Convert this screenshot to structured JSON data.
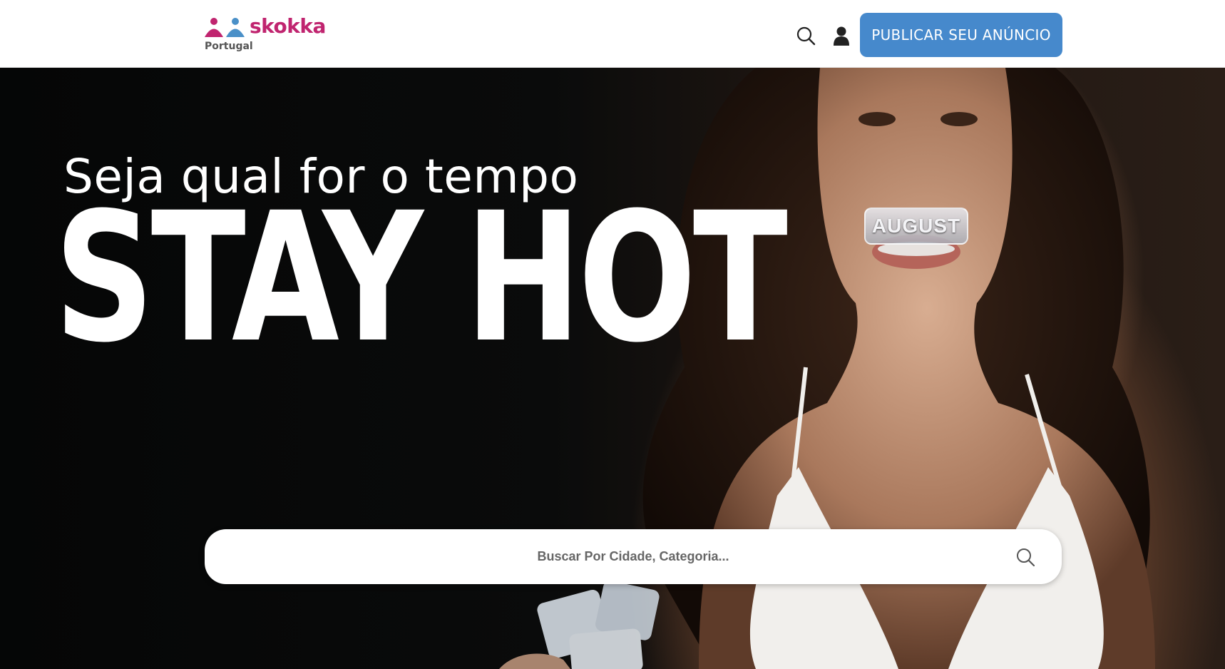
{
  "header": {
    "logo_text": "skokka",
    "logo_sub": "Portugal",
    "cta_label": "PUBLICAR SEU ANÚNCIO",
    "icons": [
      "search-icon",
      "user-icon"
    ]
  },
  "hero": {
    "tagline": "Seja qual for o tempo",
    "headline": "STAY HOT",
    "ice_text": "AUGUST"
  },
  "search": {
    "placeholder": "Buscar Por Cidade, Categoria..."
  },
  "colors": {
    "brand": "#c0246f",
    "brand_secondary": "#4a90c8",
    "cta": "#4689cc"
  }
}
